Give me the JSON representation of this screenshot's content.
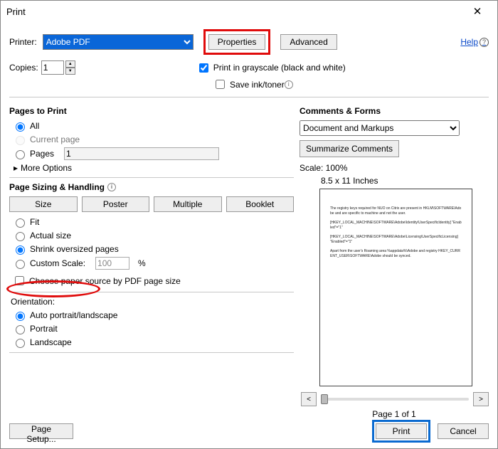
{
  "window": {
    "title": "Print"
  },
  "printerRow": {
    "label": "Printer:",
    "selected": "Adobe PDF",
    "propertiesBtn": "Properties",
    "advancedBtn": "Advanced"
  },
  "help": "Help",
  "copies": {
    "label": "Copies:",
    "value": "1"
  },
  "options": {
    "grayscale": "Print in grayscale (black and white)",
    "saveInk": "Save ink/toner"
  },
  "pagesSection": {
    "title": "Pages to Print",
    "all": "All",
    "current": "Current page",
    "pages": "Pages",
    "pagesValue": "1",
    "more": "More Options"
  },
  "sizing": {
    "title": "Page Sizing & Handling",
    "size": "Size",
    "poster": "Poster",
    "multiple": "Multiple",
    "booklet": "Booklet",
    "fit": "Fit",
    "actual": "Actual size",
    "shrink": "Shrink oversized pages",
    "custom": "Custom Scale:",
    "customValue": "100",
    "pct": "%",
    "choosePaper": "Choose paper source by PDF page size"
  },
  "orientation": {
    "title": "Orientation:",
    "auto": "Auto portrait/landscape",
    "portrait": "Portrait",
    "landscape": "Landscape"
  },
  "comments": {
    "title": "Comments & Forms",
    "selected": "Document and Markups",
    "summarize": "Summarize Comments"
  },
  "preview": {
    "scale": "Scale: 100%",
    "dims": "8.5 x 11 Inches",
    "line1": "The registry keys required for NUO on Citrix are present in HKLM\\SOFTWARE\\Adobe and are specific to machine and not the user.",
    "line2": "[HKEY_LOCAL_MACHINE\\SOFTWARE\\Adobe\\Identity\\UserSpecificIdentity] \"Enabled\"=\"1\"",
    "line3": "[HKEY_LOCAL_MACHINE\\SOFTWARE\\Adobe\\Licensing\\UserSpecificLicensing] \"Enabled\"=\"1\"",
    "line4": "Apart from the user's Roaming area %appdata%\\Adobe and registry HKEY_CURRENT_USER\\SOFTWARE\\Adobe should be synced.",
    "pageOf": "Page 1 of 1"
  },
  "footer": {
    "pageSetup": "Page Setup...",
    "print": "Print",
    "cancel": "Cancel"
  }
}
